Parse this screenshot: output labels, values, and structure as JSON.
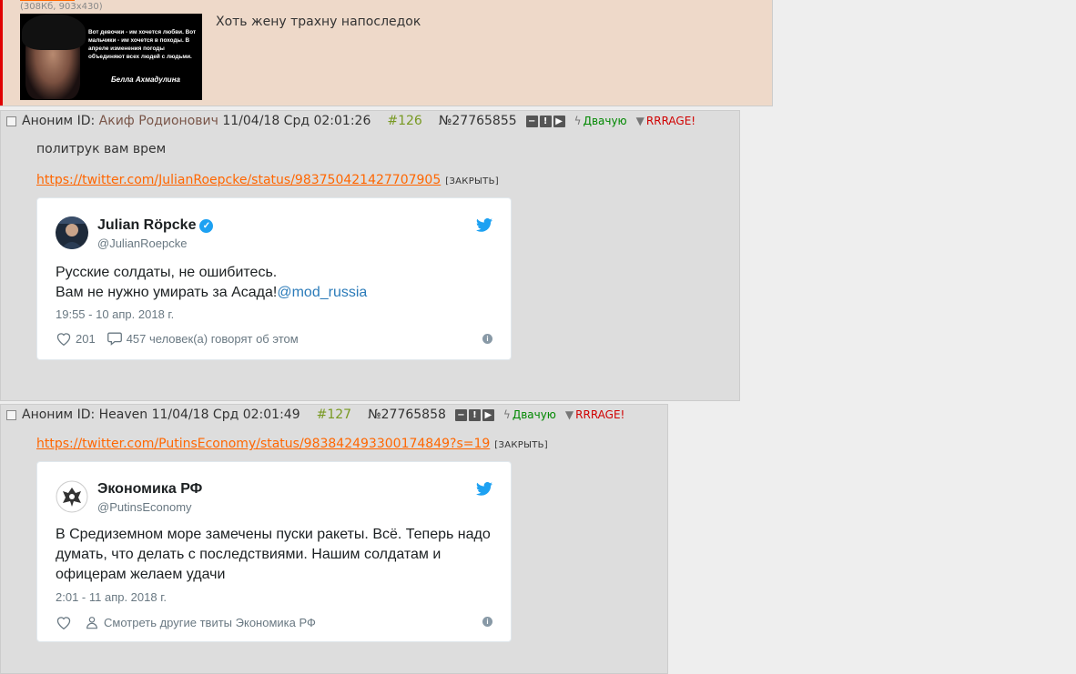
{
  "top_post": {
    "file_meta": "(308Кб, 903x430)",
    "thumb_quote": "Вот девочки - им хочется любви. Вот мальчики - им хочется в походы. В апреле изменения погоды объединяют всех людей с людьми.",
    "thumb_author": "Белла Ахмадулина",
    "message": "Хоть жену трахну напоследок"
  },
  "posts": [
    {
      "author": "Аноним",
      "id_label": "ID:",
      "id_name": "Акиф Родионович",
      "datetime": "11/04/18 Срд 02:01:26",
      "number": "#126",
      "post_id": "№27765855",
      "like_label": "Двачую",
      "dislike_label": "RRRAGE!",
      "message": "политрук вам врем",
      "link": "https://twitter.com/JulianRoepcke/status/983750421427707905",
      "close_label": "[ЗАКРЫТЬ]",
      "tweet": {
        "name": "Julian Röpcke",
        "handle": "@JulianRoepcke",
        "text_line1": "Русские солдаты, не ошибитесь.",
        "text_line2": "Вам не нужно умирать за Асада!",
        "mention": "@mod_russia",
        "date": "19:55 - 10 апр. 2018 г.",
        "likes": "201",
        "replies": "457 человек(а) говорят об этом"
      }
    },
    {
      "author": "Аноним",
      "id_label": "ID:",
      "id_name": "Heaven",
      "datetime": "11/04/18 Срд 02:01:49",
      "number": "#127",
      "post_id": "№27765858",
      "like_label": "Двачую",
      "dislike_label": "RRRAGE!",
      "link": "https://twitter.com/PutinsEconomy/status/983842493300174849?s=19",
      "close_label": "[ЗАКРЫТЬ]",
      "tweet": {
        "name": "Экономика РФ",
        "handle": "@PutinsEconomy",
        "text_line1": "В Средиземном море замечены пуски ракеты. Всё. Теперь надо",
        "text_line2": "думать, что делать с последствиями. Нашим солдатам и",
        "text_line3": "офицерам желаем удачи",
        "date": "2:01 - 11 апр. 2018 г.",
        "more": "Смотреть другие твиты Экономика РФ"
      }
    }
  ],
  "colors": {
    "link": "#ff6600",
    "post_number": "#789922",
    "like": "#008800",
    "dislike": "#d00000",
    "twitter_blue": "#1da1f2"
  }
}
